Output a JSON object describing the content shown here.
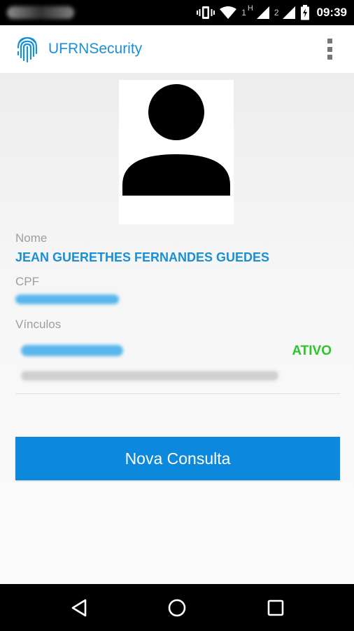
{
  "status_bar": {
    "sim1_label": "1",
    "network_type": "H",
    "sim2_label": "2",
    "time": "09:39"
  },
  "app_bar": {
    "title": "UFRNSecurity",
    "logo_icon": "fingerprint-icon",
    "menu_icon": "more-vert-icon"
  },
  "profile": {
    "avatar_icon": "person-placeholder-icon",
    "name_label": "Nome",
    "name_value": "JEAN GUERETHES FERNANDES GUEDES",
    "cpf_label": "CPF",
    "vinculos_label": "Vínculos",
    "vinculo_status": "ATIVO"
  },
  "actions": {
    "new_query_label": "Nova Consulta"
  },
  "nav_bar": {
    "back_icon": "back-triangle-icon",
    "home_icon": "home-circle-icon",
    "recents_icon": "recents-square-icon"
  },
  "colors": {
    "accent": "#1a8fd6",
    "button": "#0c88dc",
    "active_status": "#2dc52d",
    "label_gray": "#9e9e9e"
  }
}
